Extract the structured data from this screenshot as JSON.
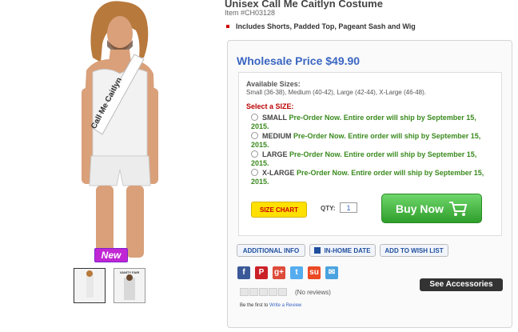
{
  "product": {
    "title": "Unisex Call Me Caitlyn Costume",
    "item_number": "Item #CH03128",
    "bullet": "Includes Shorts, Padded Top, Pageant Sash and Wig",
    "photo_sash_text": "Call Me Caitlyn",
    "badge": "New"
  },
  "pricing": {
    "price_label": "Wholesale Price $49.90"
  },
  "sizes": {
    "available_title": "Available Sizes:",
    "available_list": "Small (36-38), Medium (40-42), Large (42-44), X-Large (46-48).",
    "select_label": "Select a SIZE:",
    "options": [
      {
        "name": "SMALL",
        "note": "Pre-Order Now. Entire order will ship by September 15, 2015."
      },
      {
        "name": "MEDIUM",
        "note": "Pre-Order Now. Entire order will ship by September 15, 2015."
      },
      {
        "name": "LARGE",
        "note": "Pre-Order Now. Entire order will ship by September 15, 2015."
      },
      {
        "name": "X-LARGE",
        "note": "Pre-Order Now. Entire order will ship by September 15, 2015."
      }
    ]
  },
  "actions": {
    "size_chart": "SIZE CHART",
    "qty_label": "QTY:",
    "qty_value": "1",
    "buy_now": "Buy Now",
    "additional_info": "ADDITIONAL INFO",
    "in_home_date": "IN-HOME DATE",
    "add_to_wish_list": "ADD TO WISH LIST",
    "see_accessories": "See Accessories"
  },
  "share": {
    "icons": [
      "facebook-icon",
      "pinterest-icon",
      "google-plus-icon",
      "twitter-icon",
      "stumbleupon-icon",
      "email-icon"
    ],
    "colors": [
      "#3b5998",
      "#cb2027",
      "#dd4b39",
      "#55acee",
      "#eb4924",
      "#4aa3df"
    ]
  },
  "reviews": {
    "count_text": "(No reviews)",
    "first_prefix": "Be the first to",
    "write_link": "Write a Review"
  },
  "thumbnail_text": "VANITY FAIR"
}
